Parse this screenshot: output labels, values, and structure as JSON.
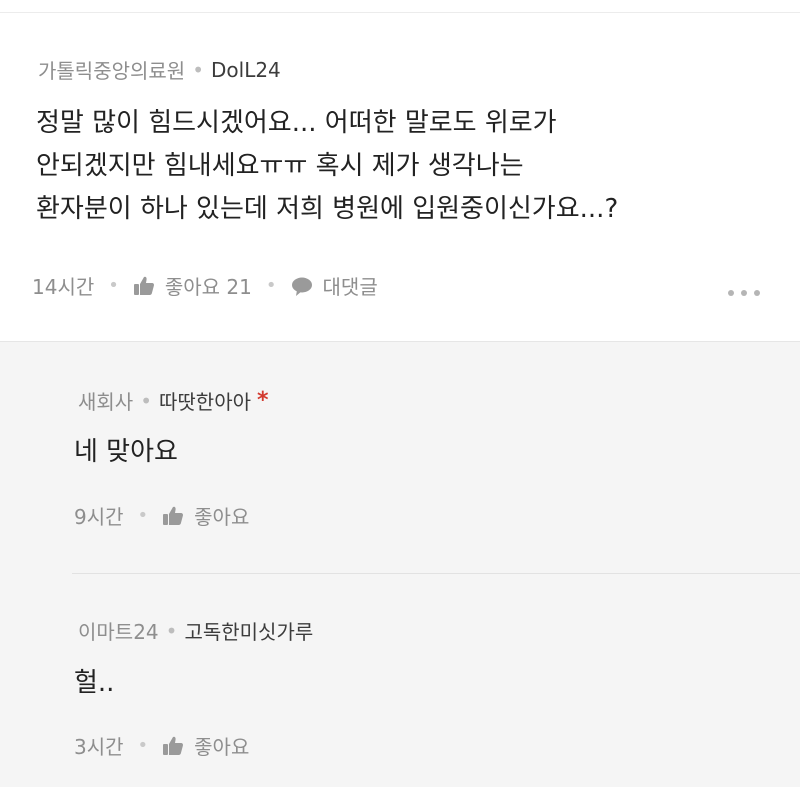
{
  "main_comment": {
    "affiliation": "가톨릭중앙의료원",
    "nickname": "DolL24",
    "lines": [
      "정말 많이 힘드시겠어요... 어떠한 말로도 위로가",
      "안되겠지만 힘내세요ㅠㅠ 혹시 제가 생각나는",
      "환자분이 하나 있는데 저희 병원에 입원중이신가요...?"
    ],
    "time": "14시간",
    "like_label": "좋아요 21",
    "reply_label": "대댓글"
  },
  "replies": [
    {
      "affiliation": "새회사",
      "nickname": "따땃한아아",
      "author_mark": "*",
      "text": "네 맞아요",
      "time": "9시간",
      "like_label": "좋아요"
    },
    {
      "affiliation": "이마트24",
      "nickname": "고독한미싯가루",
      "text": "헐..",
      "time": "3시간",
      "like_label": "좋아요"
    }
  ],
  "icons": {
    "like": "thumbs-up-icon",
    "reply": "speech-bubble-icon",
    "more": "more-dots-icon"
  },
  "colors": {
    "author_mark": "#d23a2f",
    "reply_background": "#f5f5f5"
  }
}
